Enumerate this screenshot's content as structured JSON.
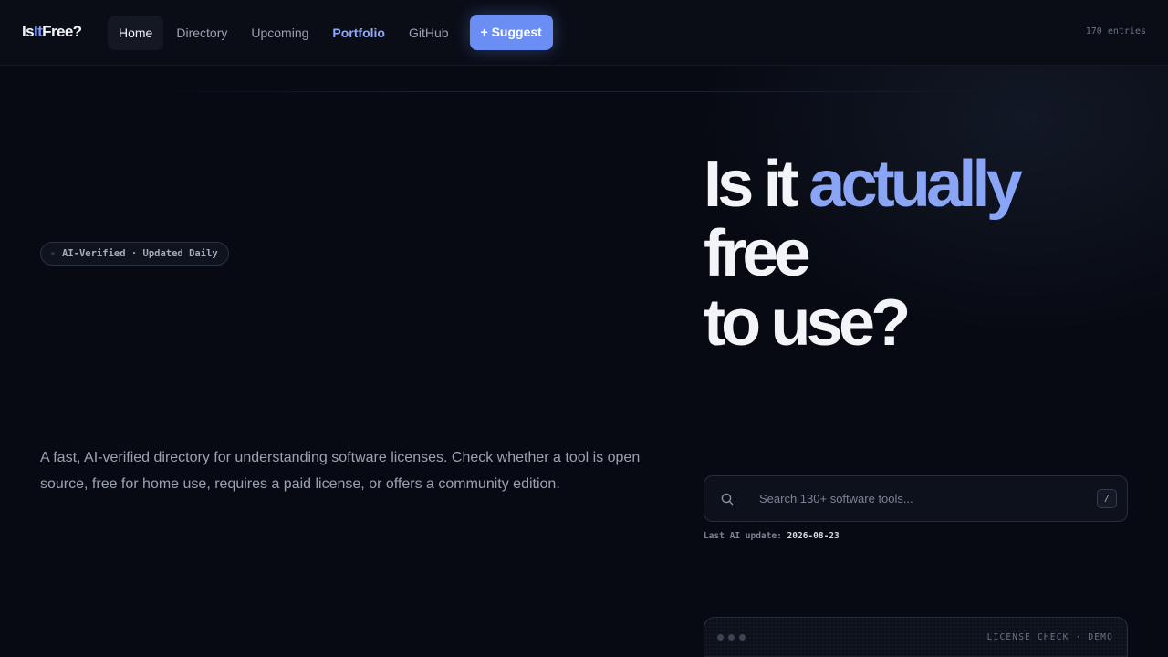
{
  "brand": {
    "prefix": "Is",
    "accent": "It",
    "suffix": "Free?"
  },
  "nav": {
    "items": [
      {
        "label": "Home",
        "active": true
      },
      {
        "label": "Directory"
      },
      {
        "label": "Upcoming"
      },
      {
        "label": "Portfolio"
      },
      {
        "label": "GitHub"
      }
    ],
    "suggest_label": "+ Suggest",
    "entries": "170 entries"
  },
  "hero": {
    "badge": "AI-Verified · Updated Daily",
    "headline": {
      "part1": "Is it ",
      "highlight": "actually",
      "line2": "free",
      "line3": "to use?"
    },
    "description": "A fast, AI-verified directory for understanding software licenses. Check whether a tool is open source, free for home use, requires a paid license, or offers a community edition."
  },
  "search": {
    "placeholder": "Search 130+ software tools...",
    "value": "",
    "shortcut": "/"
  },
  "update": {
    "label": "Last AI update:",
    "date": "2026-08-23"
  },
  "demo": {
    "label": "LICENSE CHECK · DEMO"
  },
  "colors": {
    "accent": "#6b8ef5",
    "highlight": "#8aa5f5",
    "background": "#070a12"
  }
}
